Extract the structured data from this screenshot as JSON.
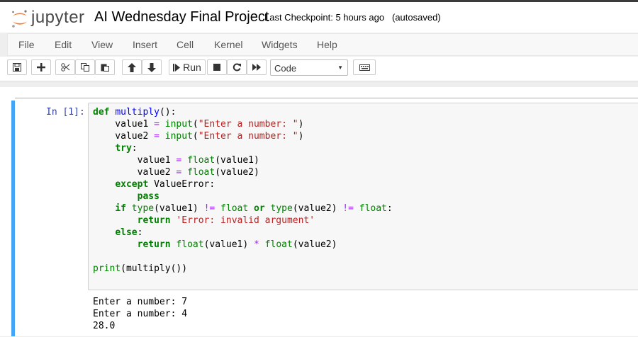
{
  "header": {
    "logo_text": "jupyter",
    "notebook_title": "AI Wednesday Final Project",
    "checkpoint": "Last Checkpoint: 5 hours ago",
    "autosave_status": "(autosaved)"
  },
  "menu": [
    "File",
    "Edit",
    "View",
    "Insert",
    "Cell",
    "Kernel",
    "Widgets",
    "Help"
  ],
  "toolbar": {
    "run_label": "Run",
    "cell_type": "Code"
  },
  "cell": {
    "prompt": "In [1]:",
    "code": {
      "l1_kw": "def",
      "l1_fn": "multiply",
      "l1_rest": "():",
      "l2_a": "    value1 ",
      "l2_op": "=",
      "l2_sp": " ",
      "l2_bi": "input",
      "l2_p1": "(",
      "l2_str": "\"Enter a number: \"",
      "l2_p2": ")",
      "l3_a": "    value2 ",
      "l3_op": "=",
      "l3_sp": " ",
      "l3_bi": "input",
      "l3_p1": "(",
      "l3_str": "\"Enter a number: \"",
      "l3_p2": ")",
      "l4_kw": "try",
      "l4_rest": ":",
      "l5_a": "        value1 ",
      "l5_op": "=",
      "l5_sp": " ",
      "l5_bi": "float",
      "l5_rest": "(value1)",
      "l6_a": "        value2 ",
      "l6_op": "=",
      "l6_sp": " ",
      "l6_bi": "float",
      "l6_rest": "(value2)",
      "l7_kw": "except",
      "l7_rest": " ValueError:",
      "l8_kw": "pass",
      "l9_kw": "if",
      "l9_sp1": " ",
      "l9_bi1": "type",
      "l9_r1": "(value1) ",
      "l9_op1": "!=",
      "l9_sp2": " ",
      "l9_bi2": "float",
      "l9_sp3": " ",
      "l9_kw2": "or",
      "l9_sp4": " ",
      "l9_bi3": "type",
      "l9_r2": "(value2) ",
      "l9_op2": "!=",
      "l9_sp5": " ",
      "l9_bi4": "float",
      "l9_r3": ":",
      "l10_kw": "return",
      "l10_sp": " ",
      "l10_str": "'Error: invalid argument'",
      "l11_kw": "else",
      "l11_rest": ":",
      "l12_kw": "return",
      "l12_sp": " ",
      "l12_bi1": "float",
      "l12_r1": "(value1) ",
      "l12_op": "*",
      "l12_sp2": " ",
      "l12_bi2": "float",
      "l12_r2": "(value2)",
      "l14_bi": "print",
      "l14_rest": "(multiply())"
    },
    "output": [
      "Enter a number: 7",
      "Enter a number: 4",
      "28.0"
    ]
  },
  "colors": {
    "accent_cell_selected": "#42a5f5",
    "keyword": "#008000",
    "string": "#ba2121",
    "function": "#0000ff",
    "operator": "#aa22ff",
    "prompt": "#303f9f",
    "logo_orange": "#f37726"
  },
  "icons": [
    "jupyter-logo",
    "save-icon",
    "plus-icon",
    "cut-icon",
    "copy-icon",
    "paste-icon",
    "arrow-up-icon",
    "arrow-down-icon",
    "step-forward-icon",
    "stop-icon",
    "restart-icon",
    "fast-forward-icon",
    "keyboard-icon"
  ]
}
